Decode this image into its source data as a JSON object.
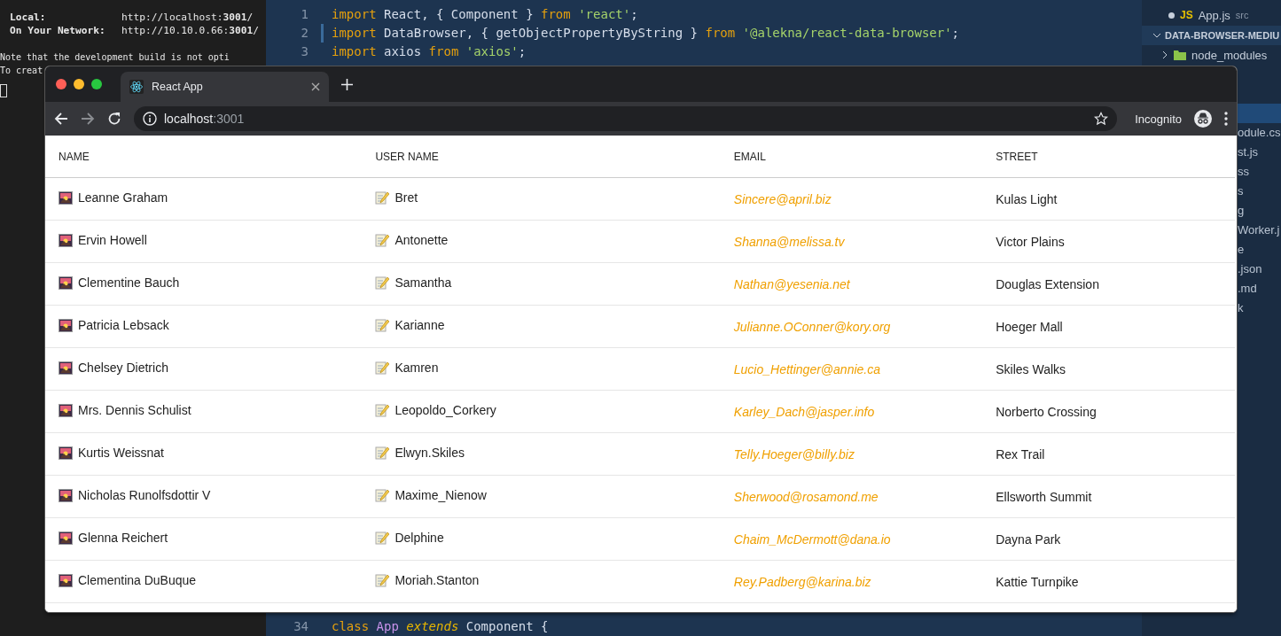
{
  "terminal": {
    "lines": [
      {
        "kind": "address",
        "label": "Local:",
        "url": "http://localhost:**3001**/"
      },
      {
        "kind": "address",
        "label": "On Your Network:",
        "url": "http://10.10.0.66:**3001**/"
      },
      {
        "kind": "blank"
      },
      {
        "kind": "text",
        "text": "Note that the development build is not opti"
      },
      {
        "kind": "text",
        "text": "To creat"
      }
    ]
  },
  "editor": {
    "top_lines": [
      {
        "number": "1",
        "modified": false,
        "tokens": [
          {
            "kind": "keyword",
            "text": "import"
          },
          {
            "kind": "plain",
            "text": " React, { Component } "
          },
          {
            "kind": "keyword",
            "text": "from"
          },
          {
            "kind": "string",
            "text": " 'react'"
          },
          {
            "kind": "plain",
            "text": ";"
          }
        ]
      },
      {
        "number": "2",
        "modified": true,
        "tokens": [
          {
            "kind": "keyword",
            "text": "import"
          },
          {
            "kind": "plain",
            "text": " DataBrowser, { getObjectPropertyByString } "
          },
          {
            "kind": "keyword",
            "text": "from"
          },
          {
            "kind": "string",
            "text": " '@alekna/react-data-browser'"
          },
          {
            "kind": "plain",
            "text": ";"
          }
        ]
      },
      {
        "number": "3",
        "modified": false,
        "tokens": [
          {
            "kind": "keyword",
            "text": "import"
          },
          {
            "kind": "plain",
            "text": " axios "
          },
          {
            "kind": "keyword",
            "text": "from"
          },
          {
            "kind": "string",
            "text": " 'axios'"
          },
          {
            "kind": "plain",
            "text": ";"
          }
        ]
      }
    ],
    "bottom_lines": [
      {
        "number": "34",
        "modified": false,
        "tokens": [
          {
            "kind": "keyword",
            "text": "class"
          },
          {
            "kind": "class",
            "text": " App"
          },
          {
            "kind": "modifier",
            "text": " extends"
          },
          {
            "kind": "plain",
            "text": " Component {"
          }
        ]
      }
    ]
  },
  "explorer": {
    "open_file": {
      "badge": "JS",
      "name": "App.js",
      "folder": "src"
    },
    "project": "DATA-BROWSER-MEDIU",
    "folder": "node_modules",
    "partial_items": [
      "odule.cs",
      "st.js",
      "ss",
      "s",
      "g",
      "Worker.j",
      "e",
      ".json",
      ".md",
      "k"
    ]
  },
  "browser": {
    "tab": {
      "title": "React App"
    },
    "address": {
      "host": "localhost",
      "port": ":3001"
    },
    "profile": "Incognito",
    "table": {
      "columns": [
        "NAME",
        "USER NAME",
        "EMAIL",
        "STREET"
      ],
      "rows": [
        {
          "name": "Leanne Graham",
          "username": "Bret",
          "email": "Sincere@april.biz",
          "street": "Kulas Light"
        },
        {
          "name": "Ervin Howell",
          "username": "Antonette",
          "email": "Shanna@melissa.tv",
          "street": "Victor Plains"
        },
        {
          "name": "Clementine Bauch",
          "username": "Samantha",
          "email": "Nathan@yesenia.net",
          "street": "Douglas Extension"
        },
        {
          "name": "Patricia Lebsack",
          "username": "Karianne",
          "email": "Julianne.OConner@kory.org",
          "street": "Hoeger Mall"
        },
        {
          "name": "Chelsey Dietrich",
          "username": "Kamren",
          "email": "Lucio_Hettinger@annie.ca",
          "street": "Skiles Walks"
        },
        {
          "name": "Mrs. Dennis Schulist",
          "username": "Leopoldo_Corkery",
          "email": "Karley_Dach@jasper.info",
          "street": "Norberto Crossing"
        },
        {
          "name": "Kurtis Weissnat",
          "username": "Elwyn.Skiles",
          "email": "Telly.Hoeger@billy.biz",
          "street": "Rex Trail"
        },
        {
          "name": "Nicholas Runolfsdottir V",
          "username": "Maxime_Nienow",
          "email": "Sherwood@rosamond.me",
          "street": "Ellsworth Summit"
        },
        {
          "name": "Glenna Reichert",
          "username": "Delphine",
          "email": "Chaim_McDermott@dana.io",
          "street": "Dayna Park"
        },
        {
          "name": "Clementina DuBuque",
          "username": "Moriah.Stanton",
          "email": "Rey.Padberg@karina.biz",
          "street": "Kattie Turnpike"
        }
      ]
    }
  }
}
